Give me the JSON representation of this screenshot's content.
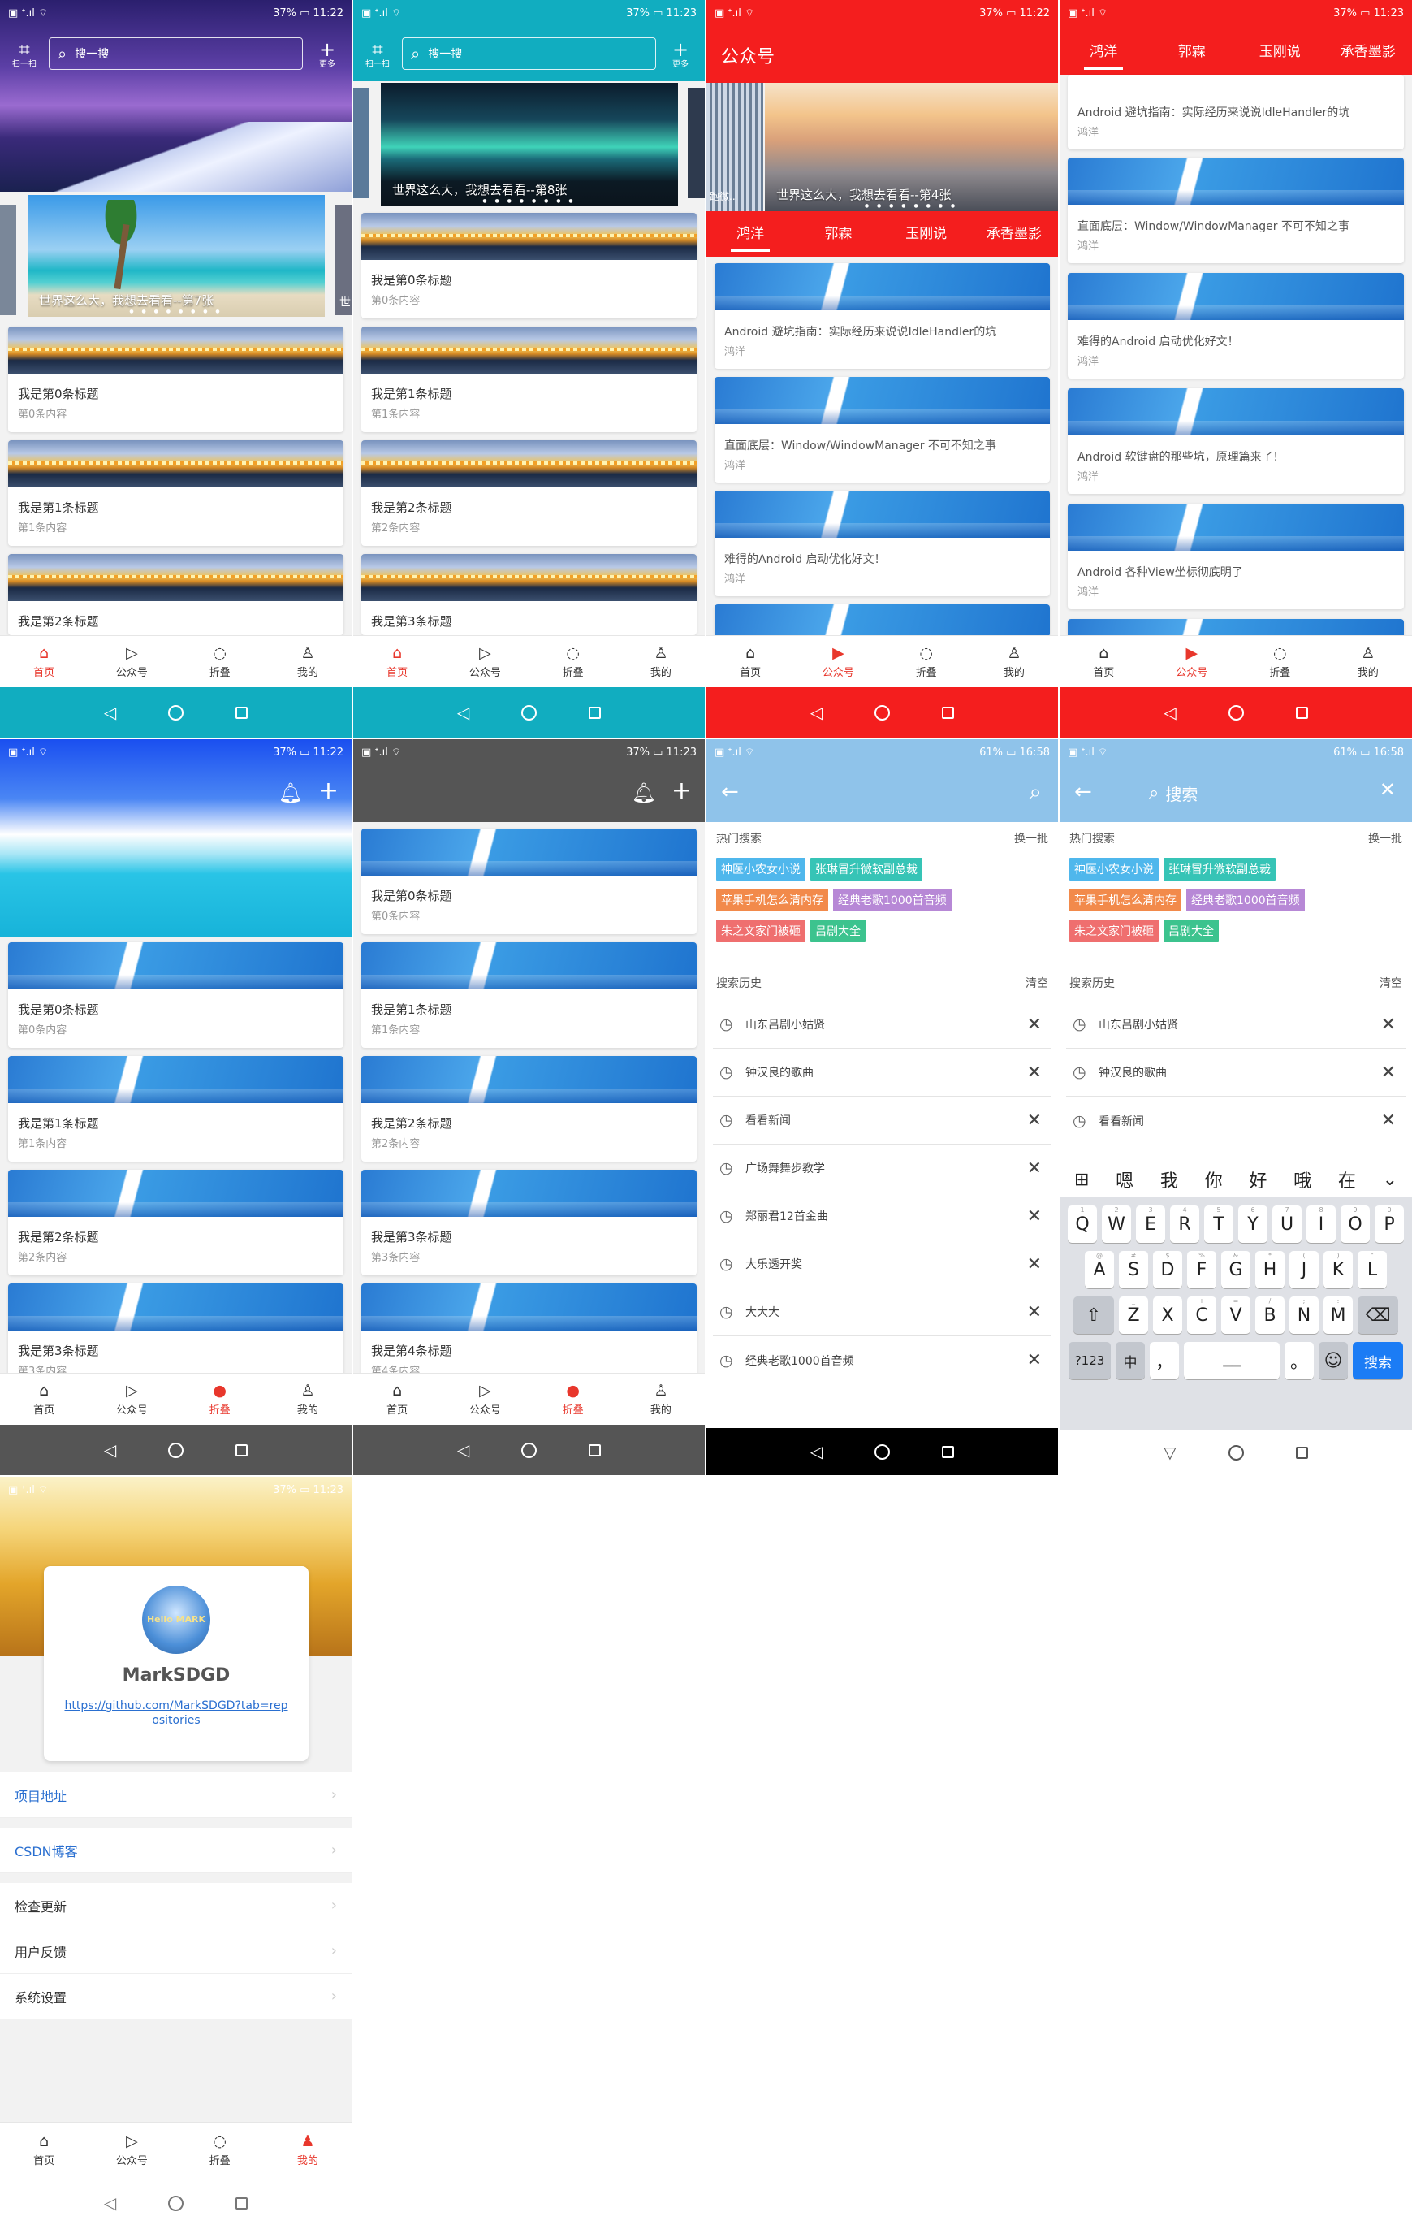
{
  "status": {
    "left_icons": "▣ ᐩ.ıl ⌔",
    "time_a": "37% ▭ 11:22",
    "time_b": "37% ▭ 11:23",
    "time_c": "61% ▭ 16:58"
  },
  "colors": {
    "teal": "#11adc0",
    "red": "#f41e1e",
    "lightblue": "#8fc3ea",
    "gray": "#555555",
    "active": "#e8372c"
  },
  "search_header": {
    "scan": "扫一扫",
    "search_placeholder": "搜一搜",
    "more": "更多"
  },
  "nav": {
    "home": "首页",
    "gzh": "公众号",
    "fold": "折叠",
    "mine": "我的"
  },
  "banners": {
    "s1": "世界这么大，我想去看看--第7张",
    "s2": "世界这么大，我想去看看--第8张",
    "s3": "世界这么大，我想去看看--第4张",
    "s3_tag": "跑微..",
    "s1_edge": "世"
  },
  "gzh": {
    "title": "公众号",
    "tabs": [
      "鸿洋",
      "郭霖",
      "玉刚说",
      "承香墨影"
    ]
  },
  "cards_a": [
    {
      "title": "我是第0条标题",
      "sub": "第0条内容"
    },
    {
      "title": "我是第1条标题",
      "sub": "第1条内容"
    },
    {
      "title": "我是第2条标题",
      "sub": ""
    }
  ],
  "cards_b": [
    {
      "title": "我是第0条标题",
      "sub": "第0条内容"
    },
    {
      "title": "我是第1条标题",
      "sub": "第1条内容"
    },
    {
      "title": "我是第2条标题",
      "sub": "第2条内容"
    },
    {
      "title": "我是第3条标题",
      "sub": ""
    }
  ],
  "articles": [
    {
      "title": "Android 避坑指南：实际经历来说说IdleHandler的坑",
      "author": "鸿洋"
    },
    {
      "title": "直面底层：Window/WindowManager 不可不知之事",
      "author": "鸿洋"
    },
    {
      "title": "难得的Android 启动优化好文！",
      "author": "鸿洋"
    },
    {
      "title": "Android 软键盘的那些坑，原理篇来了！",
      "author": "鸿洋"
    },
    {
      "title": "Android 各种View坐标彻底明了",
      "author": "鸿洋"
    }
  ],
  "cards_e": [
    {
      "title": "我是第0条标题",
      "sub": "第0条内容"
    },
    {
      "title": "我是第1条标题",
      "sub": "第1条内容"
    },
    {
      "title": "我是第2条标题",
      "sub": "第2条内容"
    },
    {
      "title": "我是第3条标题",
      "sub": "第3条内容"
    }
  ],
  "cards_f": [
    {
      "title": "我是第0条标题",
      "sub": "第0条内容"
    },
    {
      "title": "我是第1条标题",
      "sub": "第1条内容"
    },
    {
      "title": "我是第2条标题",
      "sub": "第2条内容"
    },
    {
      "title": "我是第3条标题",
      "sub": "第3条内容"
    },
    {
      "title": "我是第4条标题",
      "sub": "第4条内容"
    }
  ],
  "search": {
    "hot_title": "热门搜索",
    "refresh": "换一批",
    "history_title": "搜索历史",
    "clear": "清空",
    "placeholder": "搜索",
    "hot_tags": [
      {
        "text": "神医小农女小说",
        "color": "#4fb7ec"
      },
      {
        "text": "张琳冒升微软副总裁",
        "color": "#36c4b6"
      },
      {
        "text": "苹果手机怎么清内存",
        "color": "#f28a4b"
      },
      {
        "text": "经典老歌1000首音频",
        "color": "#b788d6"
      },
      {
        "text": "朱之文家门被砸",
        "color": "#ef6f6f"
      },
      {
        "text": "吕剧大全",
        "color": "#3cc38e"
      }
    ],
    "history": [
      "山东吕剧小姑贤",
      "钟汉良的歌曲",
      "看看新闻",
      "广场舞舞步教学",
      "郑丽君12首金曲",
      "大乐透开奖",
      "大大大",
      "经典老歌1000首音频"
    ]
  },
  "keyboard": {
    "candidates": [
      "嗯",
      "我",
      "你",
      "好",
      "哦",
      "在"
    ],
    "row1": [
      "Q",
      "W",
      "E",
      "R",
      "T",
      "Y",
      "U",
      "I",
      "O",
      "P"
    ],
    "row1_nums": [
      "1",
      "2",
      "3",
      "4",
      "5",
      "6",
      "7",
      "8",
      "9",
      "0"
    ],
    "row2": [
      "A",
      "S",
      "D",
      "F",
      "G",
      "H",
      "J",
      "K",
      "L"
    ],
    "row2_syms": [
      "@",
      "#",
      "$",
      "%",
      "&",
      "*",
      "(",
      ")",
      "\""
    ],
    "row3": [
      "Z",
      "X",
      "C",
      "V",
      "B",
      "N",
      "M"
    ],
    "row3_syms": [
      "_",
      "-",
      "+",
      "=",
      "/",
      ";",
      ":",
      "'"
    ],
    "sym": "?123",
    "lang": "中",
    "comma": "，",
    "dot": "。",
    "go": "搜索"
  },
  "profile": {
    "name": "MarkSDGD",
    "link": "https://github.com/MarkSDGD?tab=repositories",
    "avatar_text": "Hello MARK",
    "rows": [
      "项目地址",
      "CSDN博客",
      "检查更新",
      "用户反馈",
      "系统设置"
    ]
  }
}
